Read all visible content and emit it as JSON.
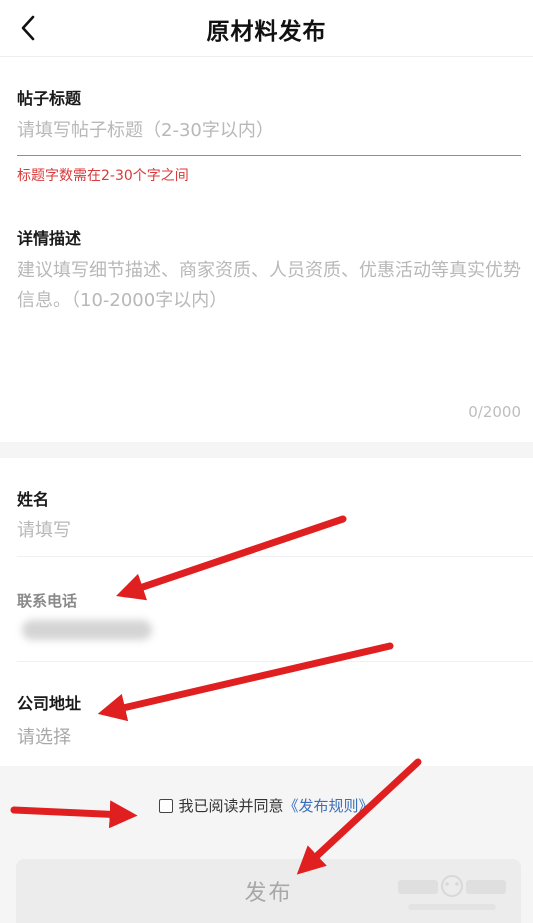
{
  "header": {
    "title": "原材料发布"
  },
  "post_title": {
    "label": "帖子标题",
    "placeholder": "请填写帖子标题（2-30字以内）",
    "error": "标题字数需在2-30个字之间"
  },
  "details": {
    "label": "详情描述",
    "placeholder": "建议填写细节描述、商家资质、人员资质、优惠活动等真实优势信息。（10-2000字以内）",
    "counter": "0/2000"
  },
  "name": {
    "label": "姓名",
    "placeholder": "请填写"
  },
  "phone": {
    "label": "联系电话"
  },
  "address": {
    "label": "公司地址",
    "placeholder": "请选择"
  },
  "agreement": {
    "text": "我已阅读并同意",
    "link": "《发布规则》"
  },
  "publish": {
    "label": "发布"
  },
  "colors": {
    "error": "#d8393a",
    "link": "#3d6fb8",
    "arrow": "#e02020"
  }
}
